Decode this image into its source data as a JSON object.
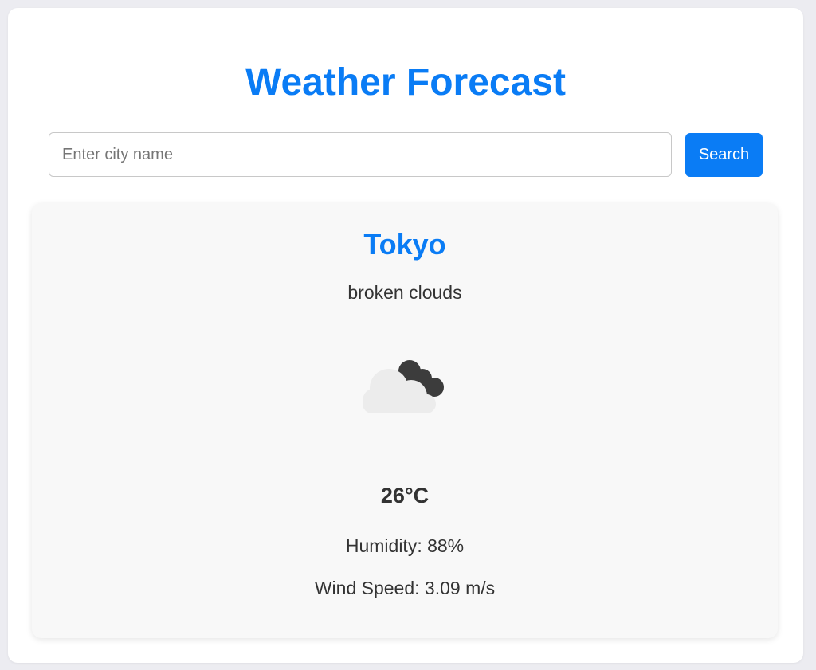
{
  "header": {
    "title": "Weather Forecast"
  },
  "search": {
    "placeholder": "Enter city name",
    "value": "",
    "button_label": "Search"
  },
  "weather": {
    "city": "Tokyo",
    "description": "broken clouds",
    "icon": "broken-clouds-icon",
    "temperature": "26°C",
    "humidity": "Humidity: 88%",
    "wind_speed": "Wind Speed: 3.09 m/s"
  },
  "colors": {
    "accent": "#0a7cf5",
    "background": "#ececf1",
    "card_background": "#f8f8f8",
    "text": "#333333"
  }
}
